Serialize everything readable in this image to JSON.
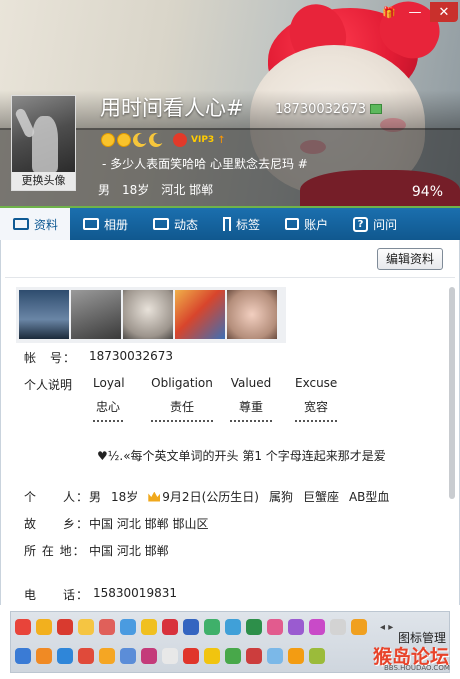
{
  "window": {
    "skin_label": "🎁",
    "minimize_label": "—",
    "close_label": "✕"
  },
  "profile": {
    "avatar_button": "更换头像",
    "nickname": "用时间看人心#",
    "qq_number": "18730032673",
    "vip_label": "VIP3",
    "vip_arrow": "↑",
    "signature": "- 多少人表面笑哈哈 心里默念去尼玛 #",
    "gender": "男",
    "age": "18岁",
    "location": "河北 邯郸",
    "completion": "94%"
  },
  "tabs": [
    {
      "label": "资料",
      "icon": "id-card-icon"
    },
    {
      "label": "相册",
      "icon": "photo-album-icon"
    },
    {
      "label": "动态",
      "icon": "feed-icon"
    },
    {
      "label": "标签",
      "icon": "bookmark-icon"
    },
    {
      "label": "账户",
      "icon": "wallet-icon"
    },
    {
      "label": "问问",
      "icon": "question-icon"
    }
  ],
  "content": {
    "edit_button": "编辑资料",
    "account_label": "帐　号：",
    "account_value": "18730032673",
    "bio_label": "个人说明",
    "words": [
      {
        "en": "Loyal",
        "cn": "忠心"
      },
      {
        "en": "Obligation",
        "cn": "责任"
      },
      {
        "en": "Valued",
        "cn": "尊重"
      },
      {
        "en": "Excuse",
        "cn": "宽容"
      }
    ],
    "bio_note": "♥½.«每个英文单词的开头 第1 个字母连起来那才是爱",
    "personal_label": "个　　人：",
    "personal": {
      "gender": "男",
      "age": "18岁",
      "birthday": "9月2日(公历生日)",
      "zodiac": "属狗",
      "constellation": "巨蟹座",
      "blood": "AB型血"
    },
    "hometown_label": "故　　乡：",
    "hometown_value": "中国 河北 邯郸 邯山区",
    "residence_label": "所 在 地：",
    "residence_value": "中国 河北 邯郸",
    "phone_label": "电　　话：",
    "phone_value": "15830019831"
  },
  "strip": {
    "arrows": "◂ ▸",
    "manage_label": "图标管理",
    "watermark": "猴岛论坛",
    "watermark_url": "BBS.HOUDAO.COM"
  },
  "colors": {
    "tab_bar": "#125f9a",
    "tab_active_bg": "#f3f6fa",
    "accent_green": "#6fb34a",
    "fox_red": "#e21c34"
  }
}
